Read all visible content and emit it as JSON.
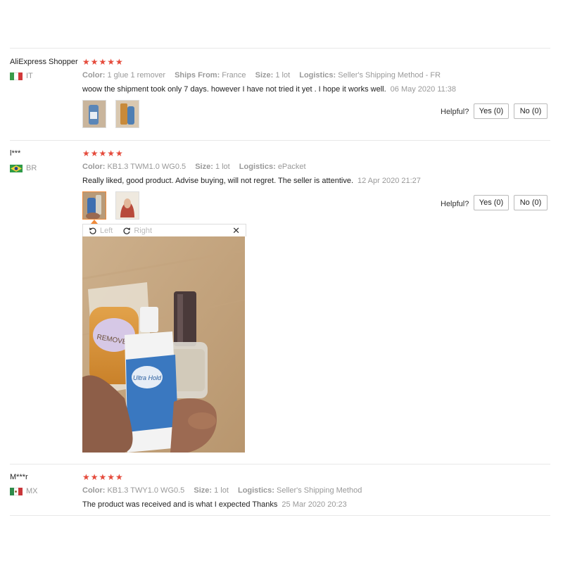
{
  "labels": {
    "color": "Color:",
    "ships_from": "Ships From:",
    "size": "Size:",
    "logistics": "Logistics:",
    "helpful": "Helpful?",
    "viewer_left": "Left",
    "viewer_right": "Right"
  },
  "reviews": [
    {
      "user": "AliExpress Shopper",
      "country": "IT",
      "stars": "★★★★★",
      "rating": 5,
      "color": "1 glue 1 remover",
      "ships_from": "France",
      "size": "1 lot",
      "logistics": "Seller's Shipping Method - FR",
      "text": "woow the shipment took only 7 days. however I have not tried it yet . I hope it works well.",
      "date": "06 May 2020 11:38",
      "yes": "Yes (0)",
      "no": "No (0)"
    },
    {
      "user": "l***",
      "country": "BR",
      "stars": "★★★★★",
      "rating": 5,
      "color": "KB1.3 TWM1.0 WG0.5",
      "size": "1 lot",
      "logistics": "ePacket",
      "text": "Really liked, good product. Advise buying, will not regret. The seller is attentive.",
      "date": "12 Apr 2020 21:27",
      "yes": "Yes (0)",
      "no": "No (0)"
    },
    {
      "user": "M***r",
      "country": "MX",
      "stars": "★★★★★",
      "rating": 5,
      "color": "KB1.3 TWY1.0 WG0.5",
      "size": "1 lot",
      "logistics": "Seller's Shipping Method",
      "text": "The product was received and is what I expected Thanks",
      "date": "25 Mar 2020 20:23"
    }
  ],
  "colors": {
    "star": "#e54b3c",
    "muted": "#999999",
    "active_thumb": "#f08a3a"
  }
}
